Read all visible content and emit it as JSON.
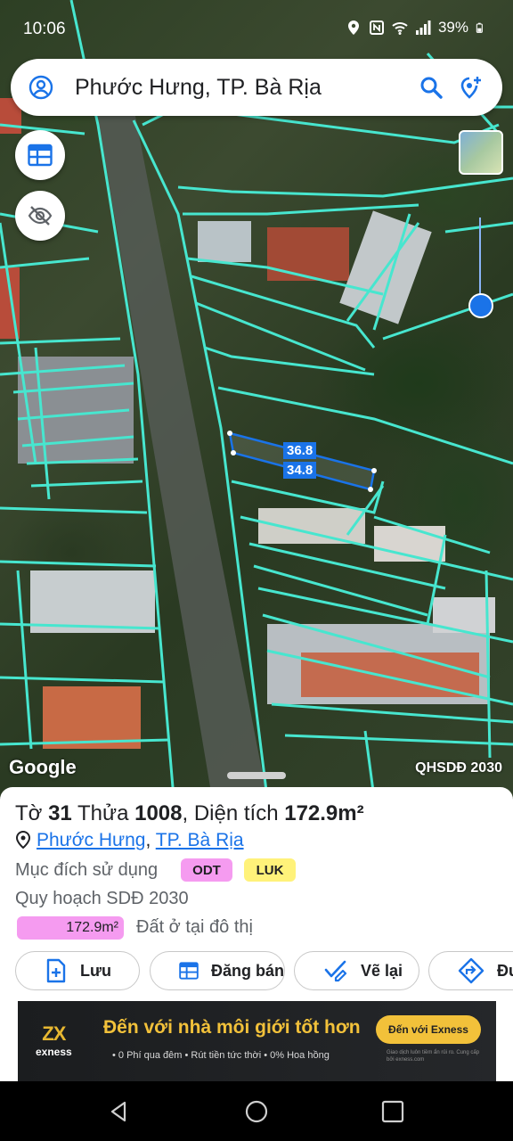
{
  "status_bar": {
    "time": "10:06",
    "battery": "39%"
  },
  "search": {
    "query": "Phước Hưng, TP. Bà Rịa"
  },
  "map": {
    "measure_top": "36.8",
    "measure_bottom": "34.8",
    "attribution": "Google",
    "plan_label": "QHSDĐ 2030",
    "boundary_color": "#47e6cf"
  },
  "parcel": {
    "title_prefix_1": "Tờ ",
    "sheet_no": "31",
    "title_prefix_2": " Thửa ",
    "parcel_no": "1008",
    "title_prefix_3": ", Diện tích ",
    "area": "172.9m²",
    "ward": "Phước Hưng",
    "separator": ",",
    "city": "TP. Bà Rịa",
    "purpose_label": "Mục đích sử dụng",
    "purpose_badges": [
      "ODT",
      "LUK"
    ],
    "plan_label": "Quy hoạch SDĐ 2030",
    "plan_area": "172.9m²",
    "plan_desc": "Đất ở tại đô thị"
  },
  "actions": [
    {
      "label": "Lưu",
      "icon": "add-file-icon"
    },
    {
      "label": "Đăng bán",
      "icon": "calendar-table-icon"
    },
    {
      "label": "Vẽ lại",
      "icon": "redraw-icon"
    },
    {
      "label": "Đườ",
      "icon": "directions-icon"
    }
  ],
  "ad": {
    "brand_mark": "ZX",
    "brand": "exness",
    "headline": "Đến với nhà môi giới tốt hơn",
    "sub": "• 0 Phí qua đêm  • Rút tiền tức thời  • 0% Hoa hồng",
    "cta": "Đến với Exness",
    "fine": "Giao dịch luôn tiềm ẩn rủi ro. Cung cấp bởi exness.com"
  },
  "colors": {
    "accent": "#1a73e8",
    "odt": "#f59bf0",
    "luk": "#fff27a"
  }
}
